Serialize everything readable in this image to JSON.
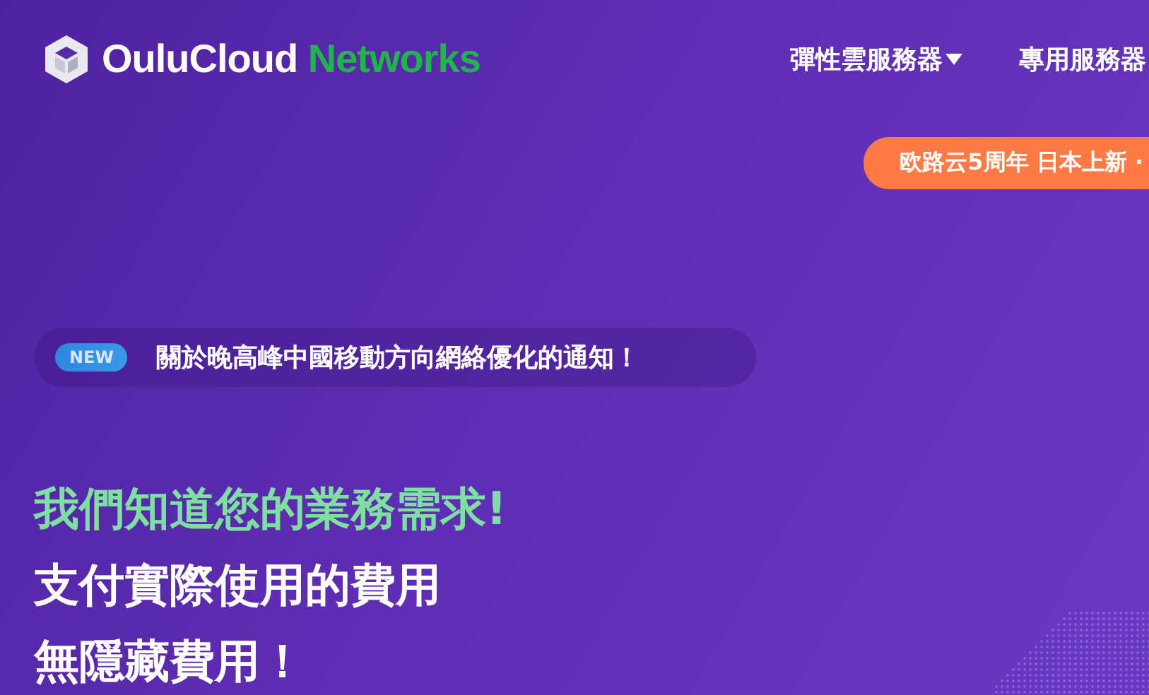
{
  "logo": {
    "name": "OuluCloud",
    "accent": "Networks"
  },
  "nav": [
    {
      "label": "彈性雲服務器",
      "dropdown": true
    },
    {
      "label": "專用服務器",
      "dropdown": false
    }
  ],
  "promo": {
    "text": "欧路云5周年 日本上新 ·"
  },
  "announcement": {
    "badge": "NEW",
    "text": "關於晚高峰中國移動方向網絡優化的通知！"
  },
  "headline": [
    {
      "text": "我們知道您的業務需求!",
      "kind": "accent"
    },
    {
      "text": "支付實際使用的費用",
      "kind": "plain"
    },
    {
      "text": "無隱藏費用！",
      "kind": "plain"
    }
  ]
}
